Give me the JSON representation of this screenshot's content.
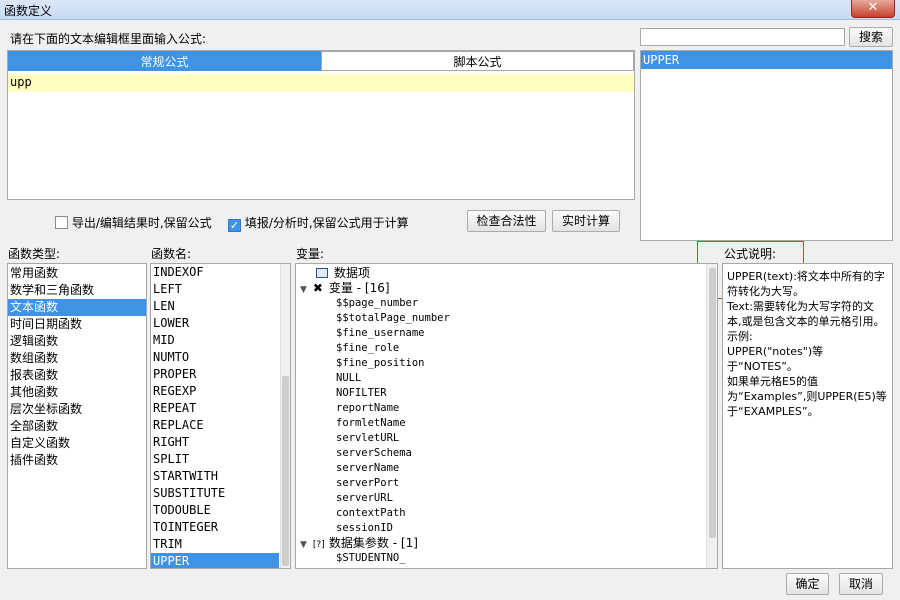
{
  "window": {
    "title": "函数定义",
    "close_label": "✕"
  },
  "search": {
    "value": "",
    "button_label": "搜索"
  },
  "editor": {
    "prompt": "请在下面的文本编辑框里面输入公式:",
    "tabs": [
      {
        "label": "常规公式",
        "active": true
      },
      {
        "label": "脚本公式",
        "active": false
      }
    ],
    "content": "upp"
  },
  "suggestions": {
    "items": [
      {
        "label": "UPPER",
        "selected": true
      }
    ]
  },
  "options": {
    "export_keep": {
      "label": "导出/编辑结果时,保留公式",
      "checked": false
    },
    "fill_keep": {
      "label": "填报/分析时,保留公式用于计算",
      "checked": true
    },
    "validate_label": "检查合法性",
    "realtime_label": "实时计算"
  },
  "function_types": {
    "label": "函数类型:",
    "items": [
      "常用函数",
      "数学和三角函数",
      "文本函数",
      "时间日期函数",
      "逻辑函数",
      "数组函数",
      "报表函数",
      "其他函数",
      "层次坐标函数",
      "全部函数",
      "自定义函数",
      "插件函数"
    ],
    "selected": "文本函数"
  },
  "function_names": {
    "label": "函数名:",
    "items": [
      "INDEXOF",
      "LEFT",
      "LEN",
      "LOWER",
      "MID",
      "NUMTO",
      "PROPER",
      "REGEXP",
      "REPEAT",
      "REPLACE",
      "RIGHT",
      "SPLIT",
      "STARTWITH",
      "SUBSTITUTE",
      "TODOUBLE",
      "TOINTEGER",
      "TRIM",
      "UPPER"
    ],
    "selected": "UPPER"
  },
  "variables": {
    "label": "变量:",
    "groups": [
      {
        "label": "数据项",
        "icon": "table-icon",
        "children": []
      },
      {
        "label": "变量 - [16]",
        "icon": "variable-icon",
        "expanded": true,
        "children": [
          "$$page_number",
          "$$totalPage_number",
          "$fine_username",
          "$fine_role",
          "$fine_position",
          "NULL",
          "NOFILTER",
          "reportName",
          "formletName",
          "servletURL",
          "serverSchema",
          "serverName",
          "serverPort",
          "serverURL",
          "contextPath",
          "sessionID"
        ]
      },
      {
        "label": "数据集参数 - [1]",
        "icon": "parameter-icon",
        "expanded": true,
        "children": [
          "$STUDENTNO_"
        ]
      }
    ]
  },
  "description": {
    "label": "公式说明:",
    "lines": [
      "UPPER(text):将文本中所有的字符转化为大写。",
      "Text:需要转化为大写字符的文本,或是包含文本的单元格引用。",
      "示例:",
      "UPPER(\"notes\")等于“NOTES”。",
      "如果单元格E5的值为“Examples”,则UPPER(E5)等于“EXAMPLES”。"
    ]
  },
  "footer": {
    "ok_label": "确定",
    "cancel_label": "取消"
  },
  "colors": {
    "accent": "#3f93e6",
    "highlight": "#ffffc0",
    "annotation": "#e23a2e"
  }
}
